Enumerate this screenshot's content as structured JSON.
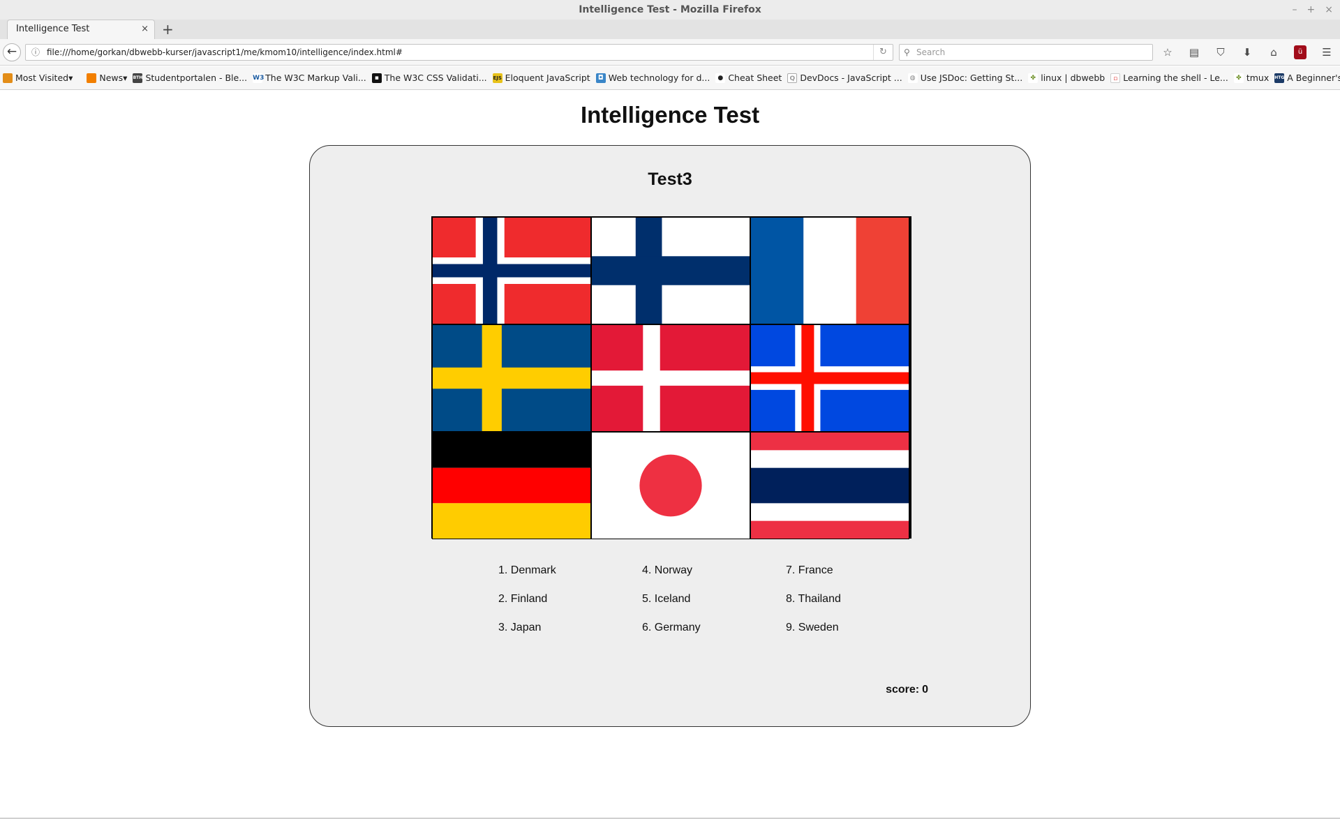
{
  "window": {
    "title": "Intelligence Test - Mozilla Firefox",
    "controls": [
      "–",
      "+",
      "×"
    ]
  },
  "tab": {
    "label": "Intelligence Test",
    "close": "×",
    "new_tab": "+"
  },
  "nav": {
    "back": "←",
    "url": "file:///home/gorkan/dbwebb-kurser/javascript1/me/kmom10/intelligence/index.html#",
    "info_icon": "ⓘ",
    "reload_icon": "↻",
    "search_placeholder": "Search",
    "search_icon": "⚲",
    "toolbar_icons": [
      "☆",
      "▤",
      "⛉",
      "⬇",
      "⌂",
      "ü",
      "☰"
    ]
  },
  "bookmarks": [
    {
      "label": "Most Visited",
      "dropdown": "▾",
      "icon": "folder-icon",
      "color": "#e38d18"
    },
    {
      "label": "News",
      "dropdown": "▾",
      "icon": "rss-icon",
      "color": "#f27f00"
    },
    {
      "label": "Studentportalen - Ble...",
      "icon": "bth-icon",
      "color": "#444444",
      "glyph": "BTH"
    },
    {
      "label": "The W3C Markup Vali...",
      "icon": "w3c-icon",
      "color": "#1a5aa0",
      "glyph": "W3"
    },
    {
      "label": "The W3C CSS Validati...",
      "icon": "css-icon",
      "color": "#111111",
      "glyph": "▪"
    },
    {
      "label": "Eloquent JavaScript",
      "icon": "ejs-icon",
      "color": "#e8c21a",
      "glyph": "EJS"
    },
    {
      "label": "Web technology for d...",
      "icon": "mdn-icon",
      "color": "#3a86c8",
      "glyph": "◘"
    },
    {
      "label": "Cheat Sheet",
      "icon": "cheat-icon",
      "color": "#222222",
      "glyph": "●"
    },
    {
      "label": "DevDocs - JavaScript ...",
      "icon": "devdocs-icon",
      "color": "#999999",
      "glyph": "Q"
    },
    {
      "label": "Use JSDoc: Getting St...",
      "icon": "globe-icon",
      "color": "#999999",
      "glyph": "◍"
    },
    {
      "label": "linux | dbwebb",
      "icon": "dbwebb-icon",
      "color": "#6b8e23",
      "glyph": "✤"
    },
    {
      "label": "Learning the shell - Le...",
      "icon": "doc-icon",
      "color": "#d33333",
      "glyph": "▫"
    },
    {
      "label": "tmux",
      "icon": "tmux-icon",
      "color": "#6b8e23",
      "glyph": "✤"
    },
    {
      "label": "A Beginner's Guide to...",
      "icon": "htg-icon",
      "color": "#1b3a66",
      "glyph": "HTG"
    }
  ],
  "page": {
    "heading": "Intelligence Test",
    "subtitle": "Test3",
    "flags": [
      {
        "name": "norway-flag"
      },
      {
        "name": "finland-flag"
      },
      {
        "name": "france-flag"
      },
      {
        "name": "sweden-flag"
      },
      {
        "name": "denmark-flag"
      },
      {
        "name": "iceland-flag"
      },
      {
        "name": "germany-flag"
      },
      {
        "name": "japan-flag"
      },
      {
        "name": "thailand-flag"
      }
    ],
    "answers": [
      "1. Denmark",
      "4. Norway",
      "7. France",
      "2. Finland",
      "5. Iceland",
      "8. Thailand",
      "3. Japan",
      "6. Germany",
      "9. Sweden"
    ],
    "score_label": "score:",
    "score_value": "0"
  },
  "colors": {
    "panel_bg": "#eeeeee",
    "norway_red": "#ef2b2d",
    "norway_blue": "#002868",
    "finland_blue": "#002f6c",
    "france_blue": "#0055a4",
    "france_red": "#ef4135",
    "sweden_blue": "#004b87",
    "sweden_yellow": "#ffcd00",
    "denmark_red": "#e31937",
    "iceland_blue": "#0048e0",
    "iceland_red": "#ff0f00",
    "germany_red": "#ff0000",
    "germany_gold": "#ffcc00",
    "japan_red": "#ee3042",
    "thailand_red": "#ed3044",
    "thailand_blue": "#00205b"
  }
}
